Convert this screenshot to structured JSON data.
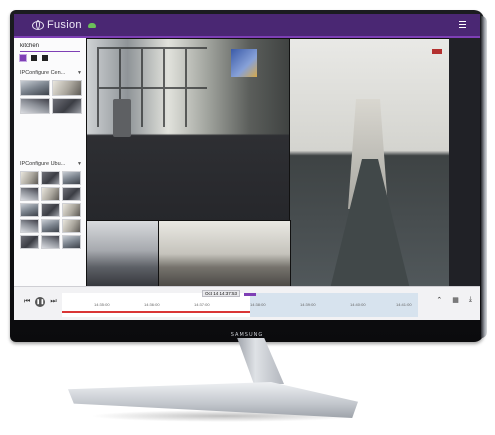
{
  "app": {
    "name": "Fusion"
  },
  "monitor": {
    "brand": "SAMSUNG"
  },
  "sidebar": {
    "search_value": "kitchen",
    "groups": [
      {
        "label": "IPConfigure Cen..."
      },
      {
        "label": "IPConfigure Ubu..."
      }
    ]
  },
  "timeline": {
    "current_time": "Oct 14 14:37:53",
    "ticks": [
      "14:35:00",
      "14:36:00",
      "14:37:00",
      "14:38:00",
      "14:39:00",
      "14:40:00",
      "14:41:00"
    ]
  },
  "colors": {
    "topbar": "#4a2773",
    "accent": "#7e3fb5",
    "recording": "#d93535",
    "future": "#d7e3ee"
  },
  "icons": [
    "fusion-logo-icon",
    "cloud-status-icon",
    "hamburger-menu-icon",
    "chevron-down-icon",
    "skip-back-icon",
    "pause-icon",
    "skip-forward-icon",
    "chevron-up-icon",
    "calendar-icon",
    "download-icon"
  ]
}
